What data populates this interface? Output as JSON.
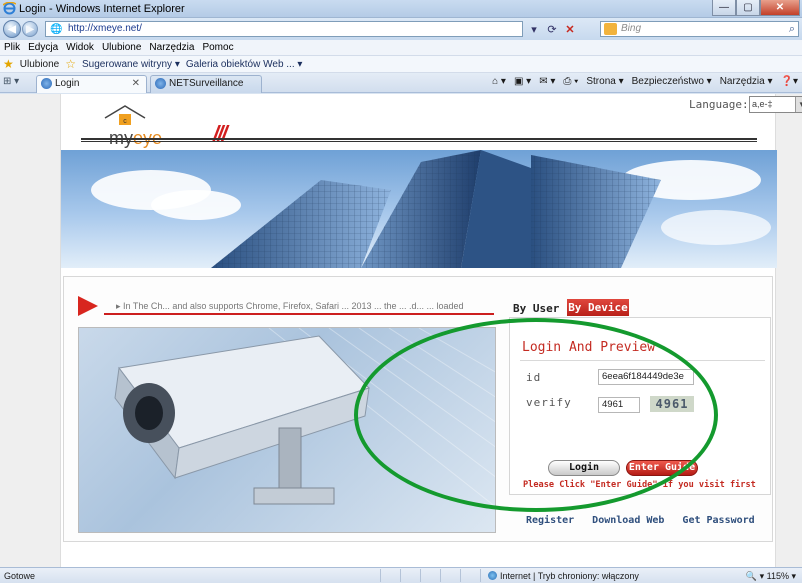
{
  "window": {
    "title": "Login - Windows Internet Explorer",
    "controls": [
      "minimize",
      "maximize",
      "close"
    ]
  },
  "address_bar": {
    "url": "http://xmeye.net/",
    "search_placeholder": "Bing"
  },
  "menu": [
    "Plik",
    "Edycja",
    "Widok",
    "Ulubione",
    "Narzędzia",
    "Pomoc"
  ],
  "favorites_bar": {
    "favorites_label": "Ulubione",
    "items": [
      "Sugerowane witryny ▾",
      "Galeria obiektów Web ... ▾"
    ]
  },
  "tabs": [
    {
      "label": "Login",
      "active": true
    },
    {
      "label": "NETSurveillance WEB",
      "active": false
    }
  ],
  "command_bar": [
    "Strona ▾",
    "Bezpieczeństwo ▾",
    "Narzędzia ▾"
  ],
  "page": {
    "logo_text_prefix": "my",
    "logo_text_suffix": "eye",
    "language_label": "Language:",
    "language_value": "a,e-‡",
    "banner_icon": "skyscrapers-image",
    "marquee": "▸ In The Ch... and also supports Chrome, Firefox, Safari  ...  2013  ...  the ... .d...  ...  loaded",
    "camera_icon": "security-camera-image",
    "tab_by_user": "By User",
    "tab_by_device": "By Device",
    "login_title": "Login And Preview",
    "id_label": "id",
    "id_value": "6eea6f184449de3e",
    "verify_label": "verify",
    "verify_value": "4961",
    "captcha_text": "4961",
    "login_button": "Login",
    "guide_button": "Enter Guide",
    "hint": "Please Click \"Enter Guide\" if you visit first",
    "links": [
      "Register",
      "Download Web",
      "Get Password"
    ]
  },
  "status_bar": {
    "ready": "Gotowe",
    "zone": "Internet | Tryb chroniony: włączony",
    "zoom": "115%"
  },
  "colors": {
    "accent_red": "#c42b22",
    "annotation_green": "#149a2e",
    "link_blue": "#2f4f7d"
  }
}
